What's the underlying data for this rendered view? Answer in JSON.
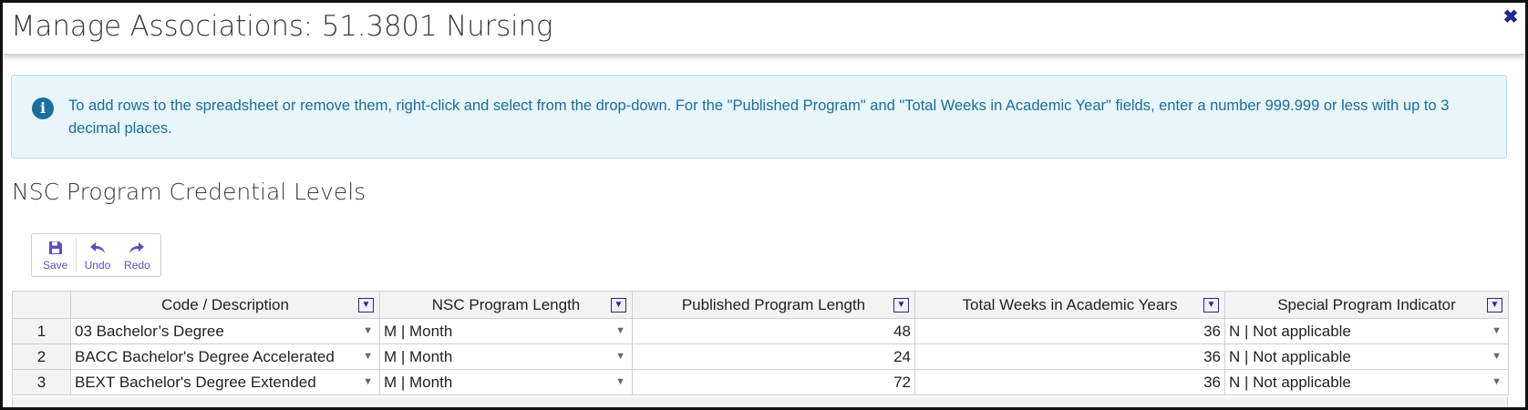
{
  "modal": {
    "title": "Manage Associations: 51.3801 Nursing",
    "close_icon": "close-icon"
  },
  "alert": {
    "icon": "info-icon",
    "icon_glyph": "i",
    "text": "To add rows to the spreadsheet or remove them, right-click and select from the drop-down. For the \"Published Program\" and \"Total Weeks in Academic Year\" fields, enter a number 999.999 or less with up to 3 decimal places."
  },
  "section": {
    "title": "NSC Program Credential Levels"
  },
  "toolbar": {
    "save_label": "Save",
    "undo_label": "Undo",
    "redo_label": "Redo"
  },
  "grid": {
    "columns": [
      "Code / Description",
      "NSC Program Length",
      "Published Program Length",
      "Total Weeks in Academic Years",
      "Special Program Indicator"
    ],
    "rows": [
      {
        "num": "1",
        "code": "03 Bachelor’s Degree",
        "length": "M | Month",
        "published": "48",
        "weeks": "36",
        "special": "N | Not applicable"
      },
      {
        "num": "2",
        "code": "BACC Bachelor's Degree Accelerated",
        "length": "M | Month",
        "published": "24",
        "weeks": "36",
        "special": "N | Not applicable"
      },
      {
        "num": "3",
        "code": "BEXT Bachelor's Degree Extended",
        "length": "M | Month",
        "published": "72",
        "weeks": "36",
        "special": "N | Not applicable"
      }
    ]
  },
  "colors": {
    "accent": "#5b4fbf",
    "info_text": "#1a6e9e",
    "info_bg": "#e8f5fa",
    "close": "#1f2a8a"
  }
}
